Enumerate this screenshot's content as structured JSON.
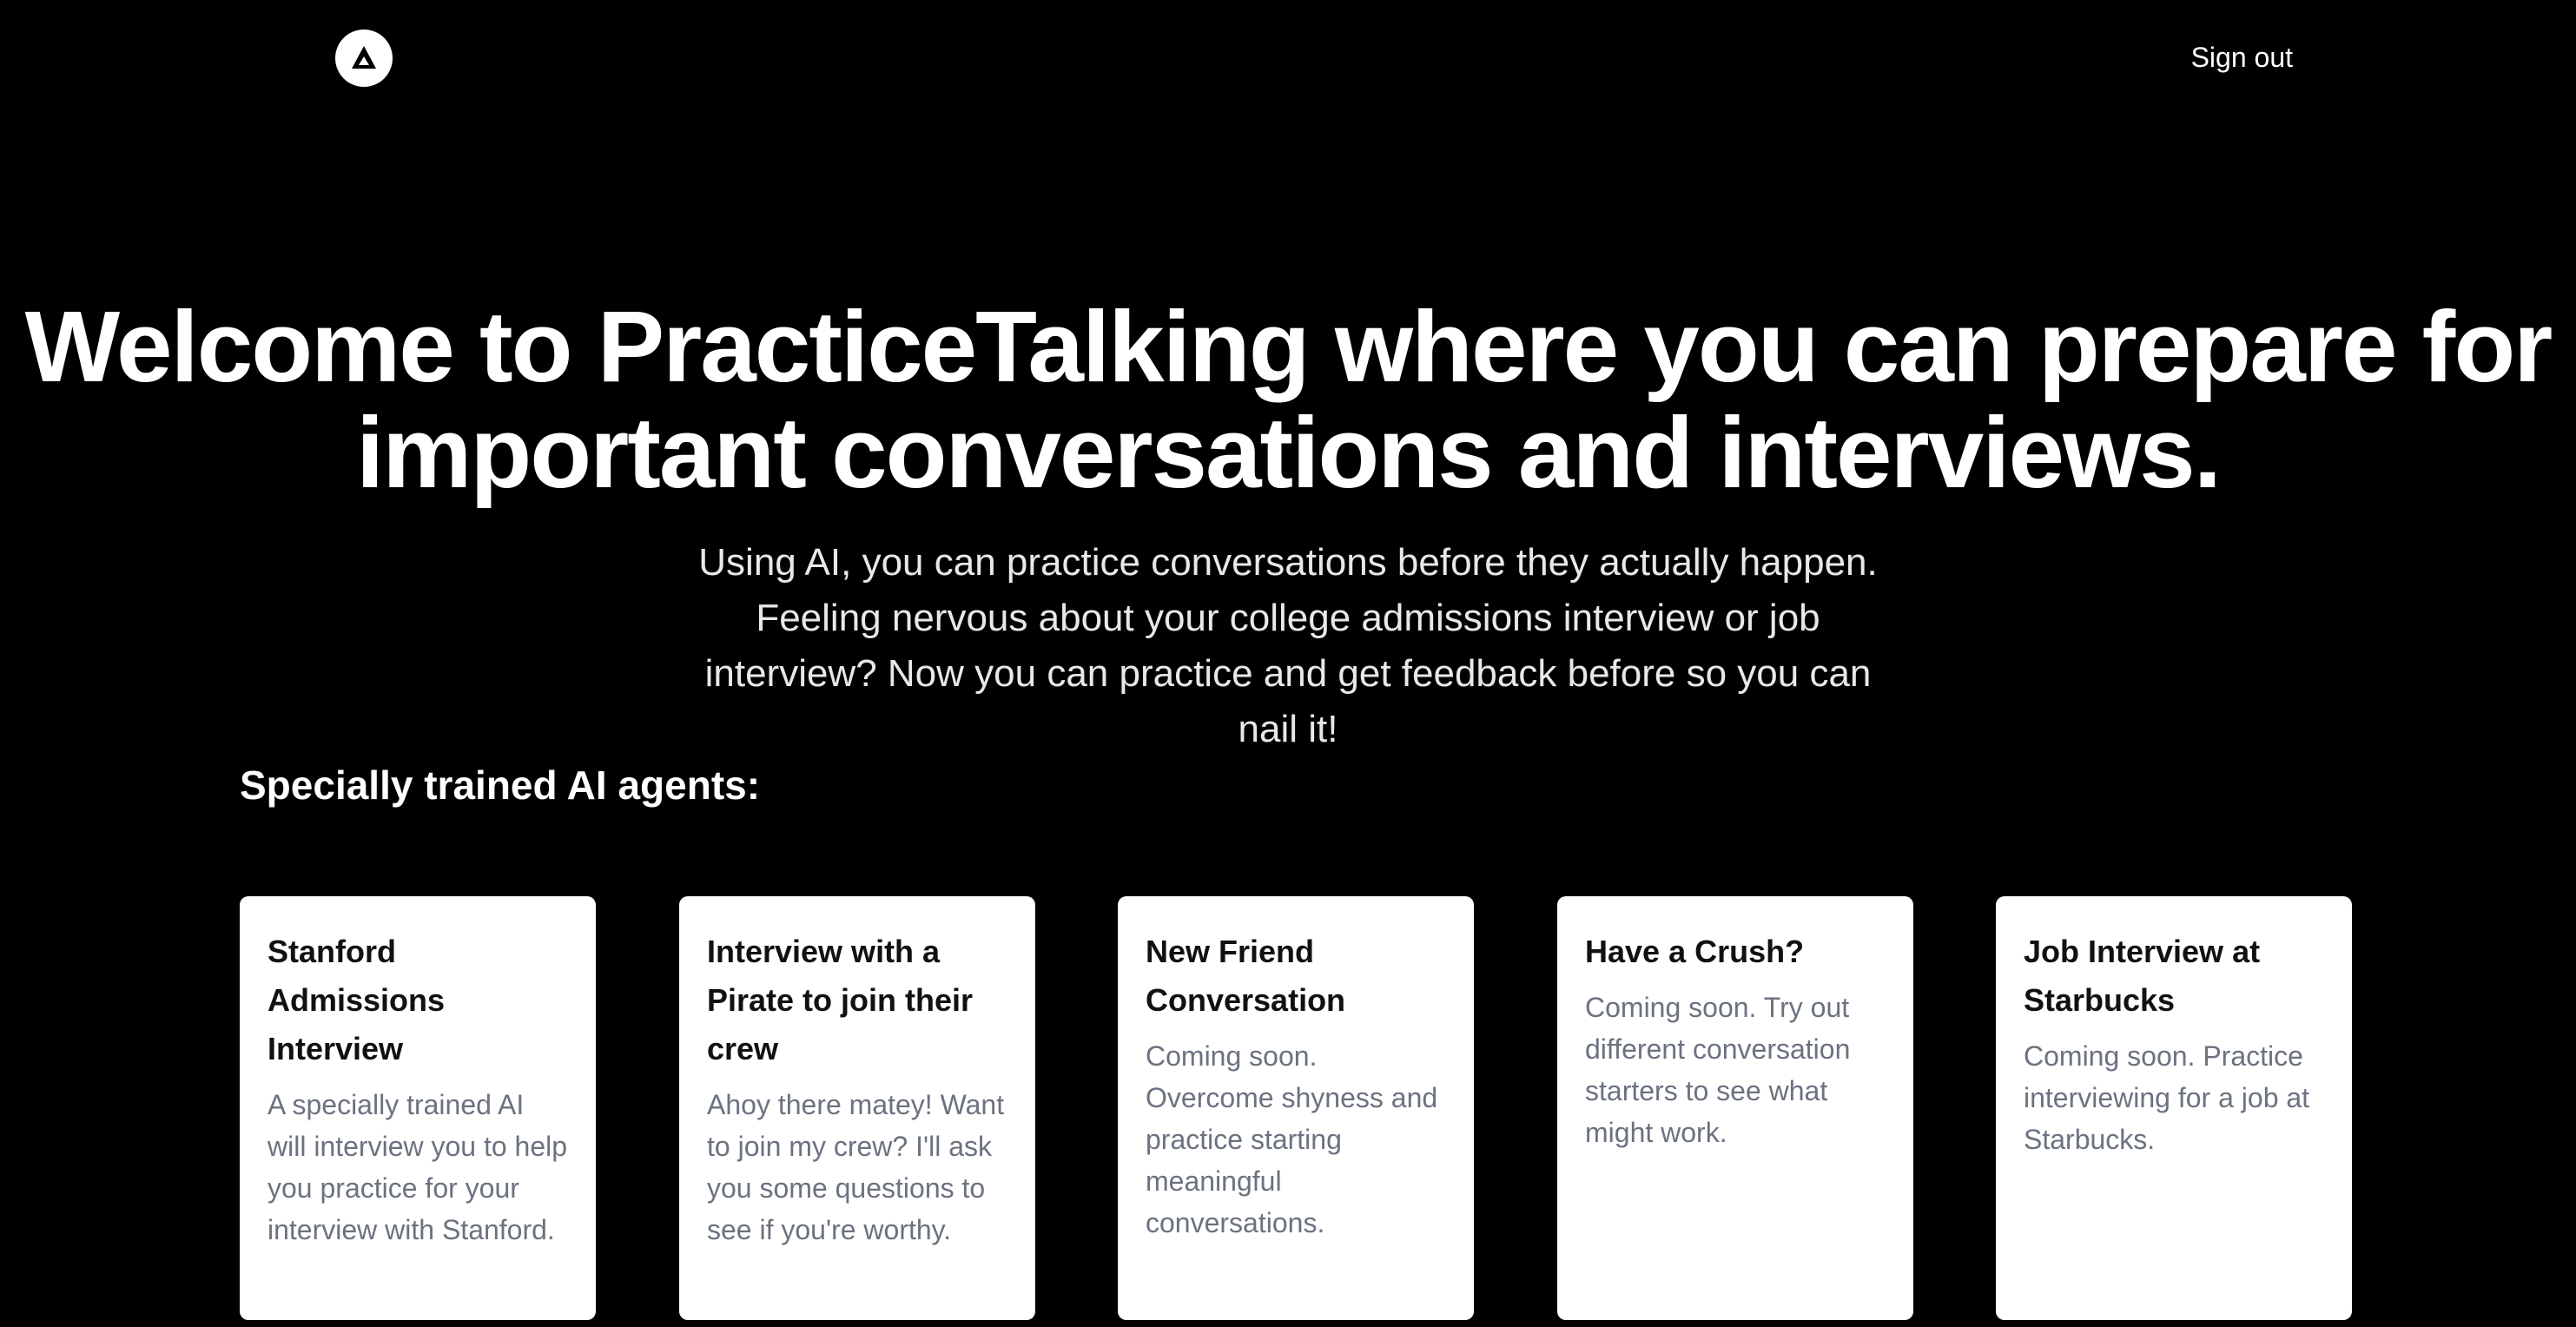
{
  "header": {
    "logo_icon": "triangle-logo-icon",
    "signout_label": "Sign out"
  },
  "hero": {
    "title": "Welcome to PracticeTalking where you can prepare for important conversations and interviews.",
    "subtitle": "Using AI, you can practice conversations before they actually happen. Feeling nervous about your college admissions interview or job interview? Now you can practice and get feedback before so you can nail it!"
  },
  "agents": {
    "heading": "Specially trained AI agents:",
    "cards": [
      {
        "title": "Stanford Admissions Interview",
        "description": "A specially trained AI will interview you to help you practice for your interview with Stanford."
      },
      {
        "title": "Interview with a Pirate to join their crew",
        "description": "Ahoy there matey! Want to join my crew? I'll ask you some questions to see if you're worthy."
      },
      {
        "title": "New Friend Conversation",
        "description": "Coming soon. Overcome shyness and practice starting meaningful conversations."
      },
      {
        "title": "Have a Crush?",
        "description": "Coming soon. Try out different conversation starters to see what might work."
      },
      {
        "title": "Job Interview at Starbucks",
        "description": "Coming soon. Practice interviewing for a job at Starbucks."
      }
    ]
  },
  "colors": {
    "background": "#000000",
    "card_background": "#ffffff",
    "card_title": "#111111",
    "card_text": "#6b7280"
  }
}
